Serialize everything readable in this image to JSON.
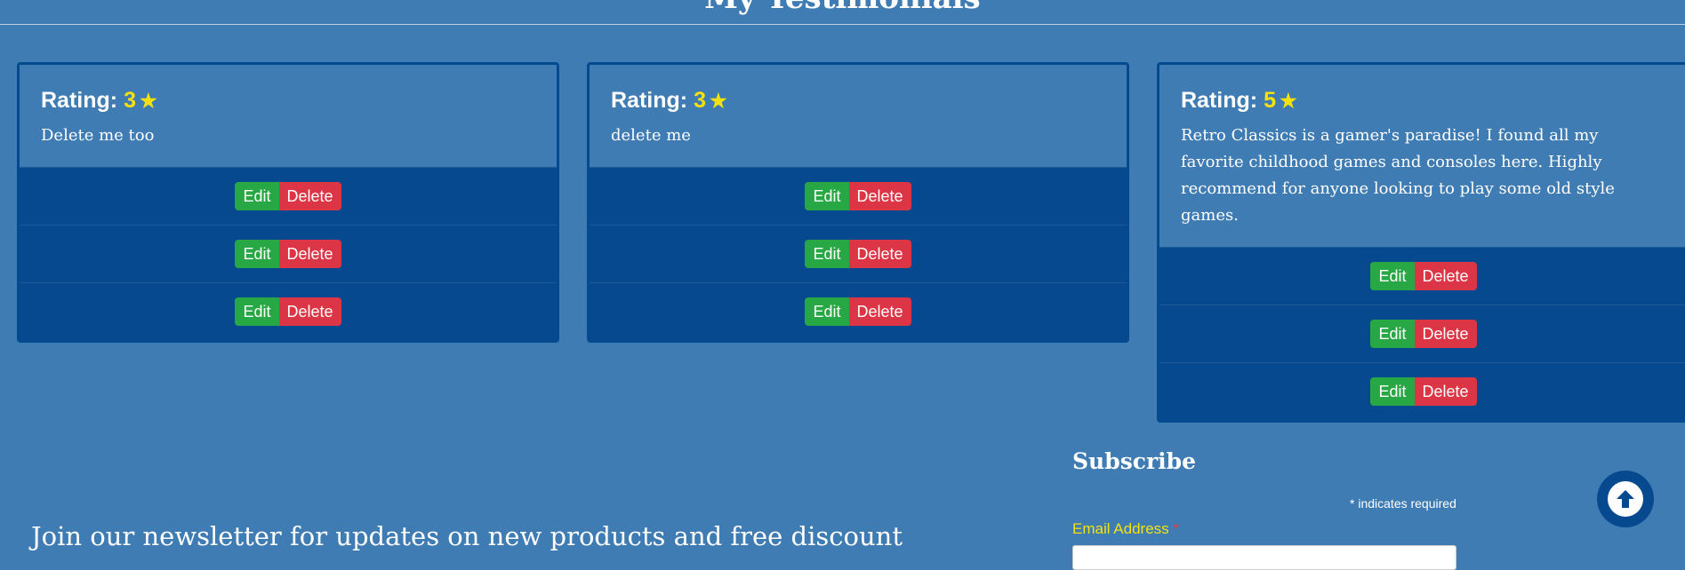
{
  "page": {
    "title": "My Testimonials"
  },
  "testimonials": [
    {
      "rating_label": "Rating:",
      "rating": "3",
      "text": "Delete me too",
      "actions": [
        {
          "edit": "Edit",
          "delete": "Delete"
        },
        {
          "edit": "Edit",
          "delete": "Delete"
        },
        {
          "edit": "Edit",
          "delete": "Delete"
        }
      ]
    },
    {
      "rating_label": "Rating:",
      "rating": "3",
      "text": "delete me",
      "actions": [
        {
          "edit": "Edit",
          "delete": "Delete"
        },
        {
          "edit": "Edit",
          "delete": "Delete"
        },
        {
          "edit": "Edit",
          "delete": "Delete"
        }
      ]
    },
    {
      "rating_label": "Rating:",
      "rating": "5",
      "text": "Retro Classics is a gamer's paradise! I found all my favorite childhood games and consoles here. Highly recommend for anyone looking to play some old style games.",
      "actions": [
        {
          "edit": "Edit",
          "delete": "Delete"
        },
        {
          "edit": "Edit",
          "delete": "Delete"
        },
        {
          "edit": "Edit",
          "delete": "Delete"
        }
      ]
    }
  ],
  "star_icon": "star-icon",
  "subscribe": {
    "title": "Subscribe",
    "required_note": "indicates required",
    "required_symbol": "*",
    "email_label": "Email Address",
    "email_value": ""
  },
  "newsletter": {
    "text": "Join our newsletter for updates on new products and free discount"
  },
  "back_to_top_icon": "arrow-up-icon",
  "colors": {
    "background": "#3f7cb3",
    "card_dark": "#06498e",
    "accent": "#f5e20d",
    "edit": "#28a745",
    "delete": "#dc3545"
  }
}
